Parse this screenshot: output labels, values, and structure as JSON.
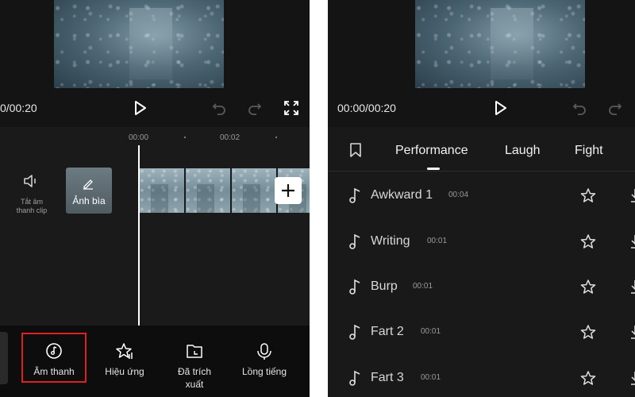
{
  "left": {
    "timecode": "0/00:20",
    "ruler": [
      "00:00",
      "00:02"
    ],
    "mute": {
      "label_line1": "Tắt âm",
      "label_line2": "thanh clip"
    },
    "cover": {
      "label": "Ảnh bìa"
    },
    "toolbar": [
      {
        "label": "Âm thanh",
        "icon": "music-disc-icon",
        "highlighted": true
      },
      {
        "label": "Hiệu ứng",
        "icon": "star-effects-icon"
      },
      {
        "label_line1": "Đã trích",
        "label_line2": "xuất",
        "icon": "folder-extract-icon"
      },
      {
        "label": "Lồng tiếng",
        "icon": "microphone-icon"
      }
    ],
    "highlight_color": "#e02020"
  },
  "right": {
    "timecode": "00:00/00:20",
    "tabs": [
      "Performance",
      "Laugh",
      "Fight"
    ],
    "active_tab": "Performance",
    "sounds": [
      {
        "name": "Awkward 1",
        "duration": "00:04"
      },
      {
        "name": "Writing",
        "duration": "00:01"
      },
      {
        "name": "Burp",
        "duration": "00:01"
      },
      {
        "name": "Fart 2",
        "duration": "00:01"
      },
      {
        "name": "Fart 3",
        "duration": "00:01"
      }
    ]
  },
  "icons": [
    "play-icon",
    "undo-icon",
    "redo-icon",
    "fullscreen-icon",
    "speaker-icon",
    "pencil-icon",
    "plus-icon",
    "bookmark-icon",
    "music-note-icon",
    "star-icon",
    "download-icon"
  ]
}
